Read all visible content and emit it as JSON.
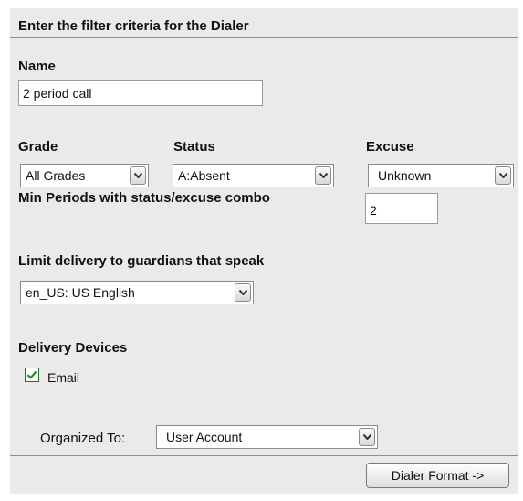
{
  "header": {
    "title": "Enter the filter criteria for the Dialer"
  },
  "name_field": {
    "label": "Name",
    "value": "2 period call"
  },
  "grade": {
    "label": "Grade",
    "selected": "All Grades"
  },
  "status": {
    "label": "Status",
    "selected": "A:Absent"
  },
  "excuse": {
    "label": "Excuse",
    "selected": "Unknown"
  },
  "min_periods": {
    "label": "Min Periods with status/excuse combo",
    "value": "2"
  },
  "language": {
    "label": "Limit delivery to guardians that speak",
    "selected": "en_US: US English"
  },
  "delivery": {
    "label": "Delivery Devices",
    "email_label": "Email",
    "email_checked": true
  },
  "organized": {
    "label": "Organized To:",
    "selected": "User Account"
  },
  "footer": {
    "next_button": "Dialer Format ->"
  },
  "icons": {
    "dropdown": "chevron-down-icon",
    "check": "checkmark-icon"
  }
}
